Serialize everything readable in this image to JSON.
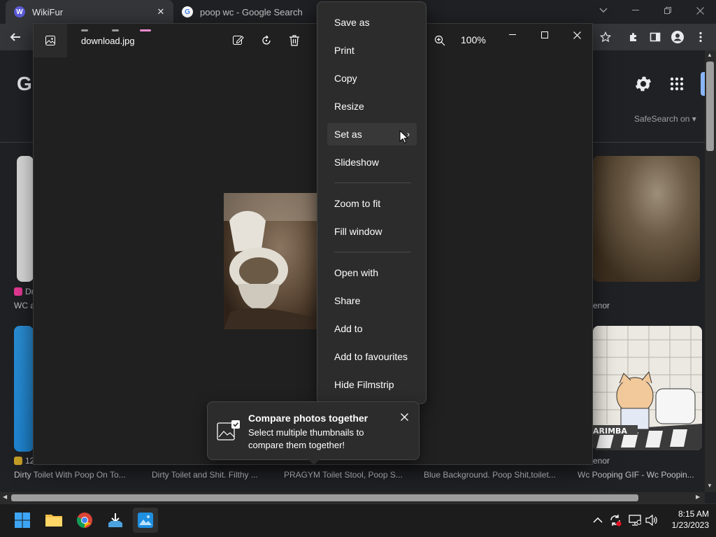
{
  "chrome": {
    "tabs": [
      {
        "title": "WikiFur",
        "favicon_icon": "wikifur-icon"
      },
      {
        "title": "poop wc - Google Search",
        "favicon_icon": "google-icon"
      }
    ],
    "close_glyph": "✕"
  },
  "google_page": {
    "logo_letter": "G",
    "safesearch": "SafeSearch on",
    "captions": [
      "Dirty Toilet With Poop On To...",
      "Dirty Toilet and Shit. Filthy ...",
      "PRAGYM Toilet Stool, Poop S...",
      "Blue Background. Poop Shit,toilet...",
      "Wc Pooping GIF - Wc Poopin..."
    ],
    "partial_left_top": {
      "source": "Dr",
      "title": "WC a"
    },
    "partial_left_bottom": {
      "source": "12"
    },
    "partial_right_top": {
      "source": "enor"
    },
    "partial_right_bottom": {
      "source": "enor"
    },
    "gif_watermark": "ARIMBA"
  },
  "photos": {
    "filename": "download.jpg",
    "zoom": "100%"
  },
  "context_menu": {
    "items": [
      {
        "label": "Save as"
      },
      {
        "label": "Print"
      },
      {
        "label": "Copy"
      },
      {
        "label": "Resize"
      },
      {
        "label": "Set as",
        "submenu": true
      },
      {
        "label": "Slideshow"
      },
      {
        "label": "Zoom to fit"
      },
      {
        "label": "Fill window"
      },
      {
        "label": "Open with"
      },
      {
        "label": "Share"
      },
      {
        "label": "Add to"
      },
      {
        "label": "Add to favourites"
      },
      {
        "label": "Hide Filmstrip"
      }
    ],
    "chevron": "›"
  },
  "tip": {
    "title": "Compare photos together",
    "body": "Select multiple thumbnails to compare them together!"
  },
  "taskbar": {
    "time": "8:15 AM",
    "date": "1/23/2023"
  },
  "colors": {
    "accent_blue": "#8ab4f8",
    "photos_accent": "#4cc2ff"
  }
}
